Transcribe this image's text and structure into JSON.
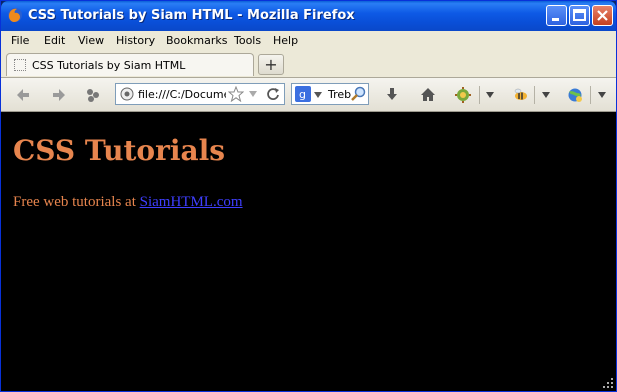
{
  "window": {
    "title": "CSS Tutorials by Siam HTML - Mozilla Firefox",
    "controls": [
      "minimize",
      "maximize",
      "close"
    ]
  },
  "menubar": {
    "items": [
      {
        "label": "File"
      },
      {
        "label": "Edit"
      },
      {
        "label": "View"
      },
      {
        "label": "History"
      },
      {
        "label": "Bookmarks"
      },
      {
        "label": "Tools"
      },
      {
        "label": "Help"
      }
    ]
  },
  "tabs": {
    "active_label": "CSS Tutorials by Siam HTML",
    "new_tab_symbol": "+"
  },
  "navbar": {
    "url": "file:///C:/Documents and Settings/",
    "search_engine_text": "Treb",
    "icons": [
      "back-icon",
      "forward-icon",
      "sync-icon",
      "globe-icon",
      "star-icon",
      "dropdown-icon",
      "reload-icon",
      "google-icon",
      "magnifier-icon",
      "download-icon",
      "home-icon",
      "addon-icon",
      "menu-dropdown-icon",
      "bee-icon",
      "menu-dropdown-icon",
      "addon-globe-icon",
      "menu-dropdown-icon"
    ]
  },
  "page": {
    "heading": "CSS Tutorials",
    "paragraph_prefix": "Free web tutorials at ",
    "link_text": "SiamHTML.com",
    "text_color": "#e7854e",
    "link_color": "#3f3fff",
    "background": "#000000"
  }
}
